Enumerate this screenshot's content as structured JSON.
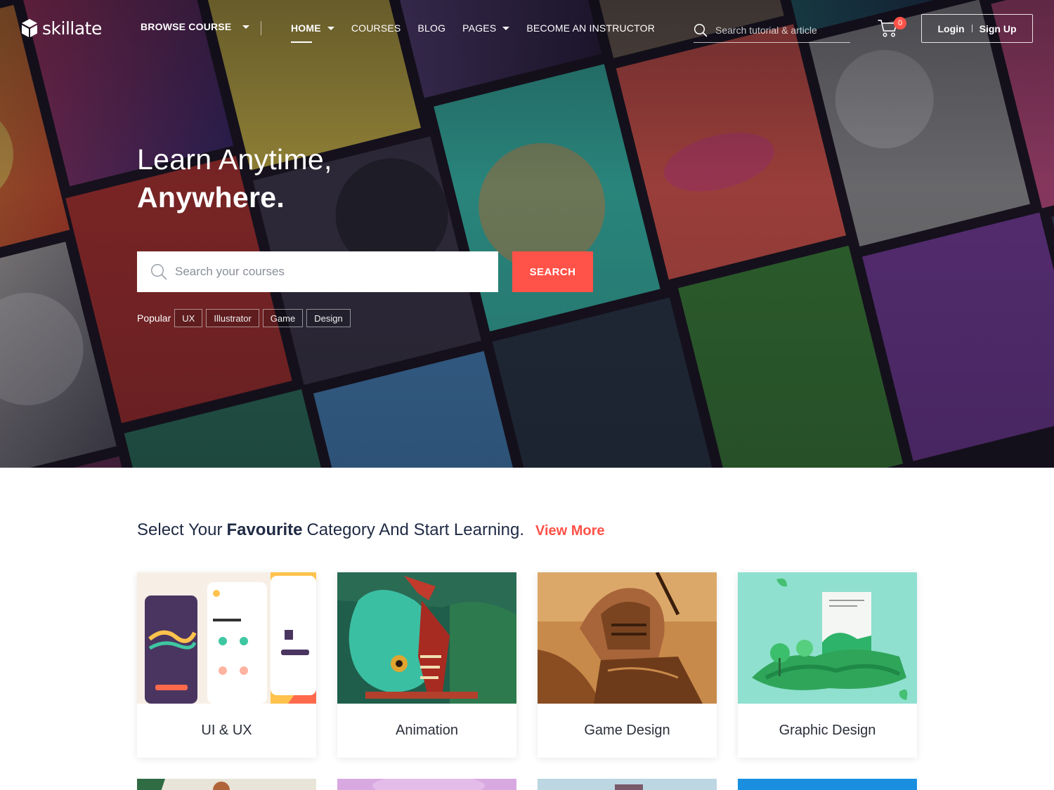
{
  "brand": {
    "name": "skillate"
  },
  "header": {
    "browse_label": "BROWSE COURSE",
    "nav": [
      {
        "label": "HOME",
        "active": true,
        "dropdown": true
      },
      {
        "label": "COURSES",
        "active": false,
        "dropdown": false
      },
      {
        "label": "BLOG",
        "active": false,
        "dropdown": false
      },
      {
        "label": "PAGES",
        "active": false,
        "dropdown": true
      },
      {
        "label": "BECOME AN INSTRUCTOR",
        "active": false,
        "dropdown": false
      }
    ],
    "search_placeholder": "Search tutorial & article",
    "cart_count": "0",
    "login_label": "Login",
    "signup_label": "Sign Up"
  },
  "hero": {
    "line1": "Learn Anytime,",
    "line2": "Anywhere.",
    "search_placeholder": "Search your courses",
    "search_button": "SEARCH",
    "popular_label": "Popular",
    "popular_tags": [
      "UX",
      "Illustrator",
      "Game",
      "Design"
    ]
  },
  "categories": {
    "title_prefix": "Select Your",
    "title_bold": "Favourite",
    "title_suffix": "Category And Start Learning.",
    "view_more": "View More",
    "items": [
      {
        "label": "UI & UX",
        "icon": "ui-ux-thumbnail"
      },
      {
        "label": "Animation",
        "icon": "animation-thumbnail"
      },
      {
        "label": "Game Design",
        "icon": "game-design-thumbnail"
      },
      {
        "label": "Graphic Design",
        "icon": "graphic-design-thumbnail"
      }
    ]
  },
  "colors": {
    "accent": "#ff5248",
    "heading": "#1f2a44",
    "hero_dark": "#1e1a24"
  }
}
